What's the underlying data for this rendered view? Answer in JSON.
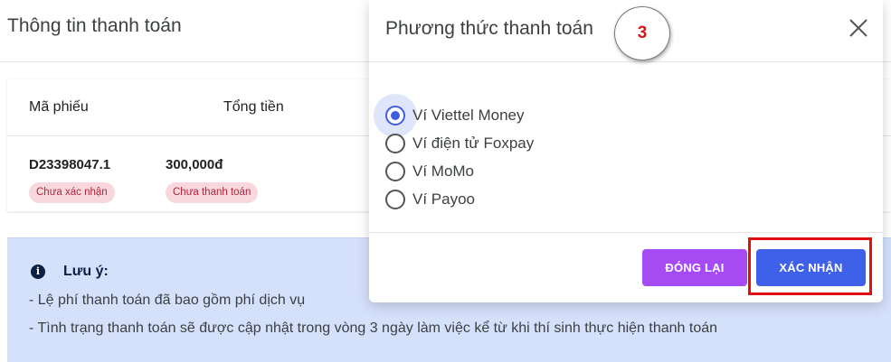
{
  "page": {
    "title": "Thông tin thanh toán"
  },
  "table": {
    "headers": [
      "Mã phiếu",
      "Tổng tiền"
    ],
    "row": {
      "code": "D23398047.1",
      "amount": "300,000đ",
      "status_confirm": "Chưa xác nhận",
      "status_payment": "Chưa thanh toán"
    }
  },
  "note": {
    "icon": "info-circle-icon",
    "icon_glyph": "i",
    "title": "Lưu ý:",
    "lines": [
      "- Lệ phí thanh toán đã bao gồm phí dịch vụ",
      "- Tình trạng thanh toán sẽ được cập nhật trong vòng 3 ngày làm việc kể từ khi thí sinh thực hiện thanh toán"
    ]
  },
  "modal": {
    "title": "Phương thức thanh toán",
    "close_icon": "close-icon",
    "options": [
      {
        "label": "Ví Viettel Money",
        "selected": true
      },
      {
        "label": "Ví điện tử Foxpay",
        "selected": false
      },
      {
        "label": "Ví MoMo",
        "selected": false
      },
      {
        "label": "Ví Payoo",
        "selected": false
      }
    ],
    "buttons": {
      "close_label": "ĐÓNG LẠI",
      "confirm_label": "XÁC NHẬN"
    }
  },
  "annotation": {
    "step_number": "3",
    "step_color": "#d11b1b",
    "highlight_color": "#e01010"
  },
  "colors": {
    "primary": "#3f60e9",
    "secondary_button": "#a64bf4",
    "badge_bg": "#f8d7dd",
    "badge_text": "#b0263b",
    "note_bg": "#d5e0fb"
  }
}
